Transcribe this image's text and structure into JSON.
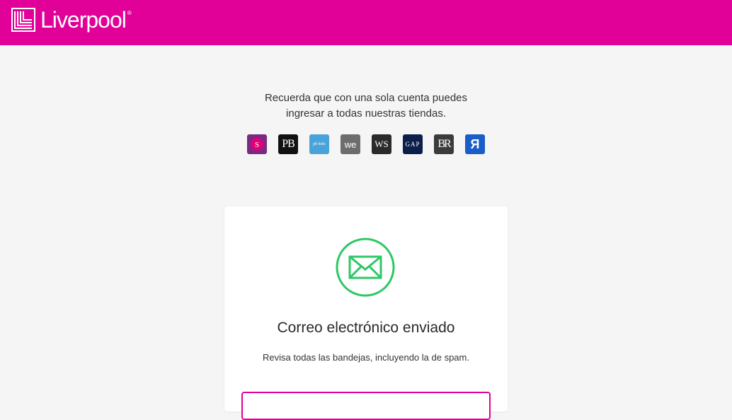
{
  "header": {
    "brand": "Liverpool",
    "registered_mark": "®",
    "color": "#e10098"
  },
  "notice": {
    "line1": "Recuerda que con una sola cuenta puedes",
    "line2": "ingresar a todas nuestras tiendas."
  },
  "stores": [
    {
      "name": "suburbia-icon",
      "glyph": "S",
      "color": "#7b2a83"
    },
    {
      "name": "pottery-barn-icon",
      "glyph": "PB",
      "color": "#111111"
    },
    {
      "name": "pottery-barn-kids-icon",
      "glyph": "pb kids",
      "color": "#4aa3d8"
    },
    {
      "name": "west-elm-icon",
      "glyph": "we",
      "color": "#6d6d6d"
    },
    {
      "name": "williams-sonoma-icon",
      "glyph": "WS",
      "color": "#2a2a2a"
    },
    {
      "name": "gap-icon",
      "glyph": "GAP",
      "color": "#0c1f4a"
    },
    {
      "name": "banana-republic-icon",
      "glyph": "BR",
      "color": "#3b3b3b"
    },
    {
      "name": "toys-r-us-icon",
      "glyph": "Я",
      "color": "#1a5dc9"
    }
  ],
  "card": {
    "icon": "envelope-icon",
    "icon_color": "#2ec866",
    "title": "Correo electrónico enviado",
    "subtitle": "Revisa todas las bandejas, incluyendo la de spam."
  }
}
